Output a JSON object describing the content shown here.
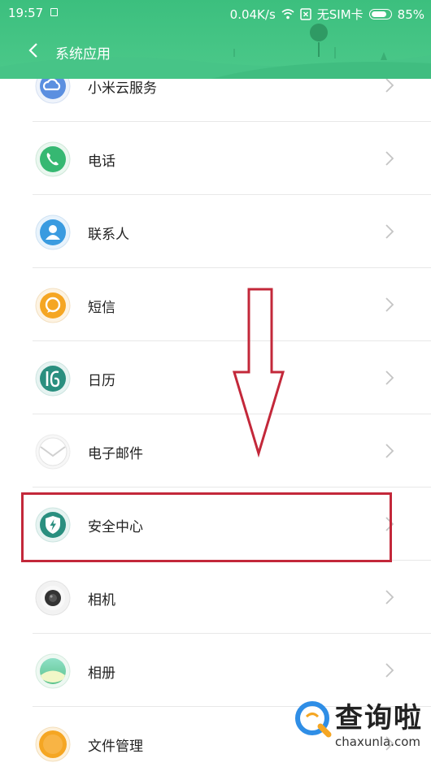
{
  "status_bar": {
    "time": "19:57",
    "speed": "0.04K/s",
    "sim": "无SIM卡",
    "battery": "85%",
    "battery_level": 0.85
  },
  "nav": {
    "title": "系统应用"
  },
  "apps": [
    {
      "label": "小米云服务",
      "icon": "cloud-icon",
      "color": "#5b8fe0"
    },
    {
      "label": "电话",
      "icon": "phone-icon",
      "color": "#36b872"
    },
    {
      "label": "联系人",
      "icon": "contacts-icon",
      "color": "#3a9be0"
    },
    {
      "label": "短信",
      "icon": "message-icon",
      "color": "#f5a623"
    },
    {
      "label": "日历",
      "icon": "calendar-icon",
      "color": "#2a8f7f"
    },
    {
      "label": "电子邮件",
      "icon": "mail-icon",
      "color": "#e8e8e8"
    },
    {
      "label": "安全中心",
      "icon": "shield-icon",
      "color": "#2a8f7f"
    },
    {
      "label": "相机",
      "icon": "camera-icon",
      "color": "#333333"
    },
    {
      "label": "相册",
      "icon": "gallery-icon",
      "color": "#6bcf9a"
    },
    {
      "label": "文件管理",
      "icon": "folder-icon",
      "color": "#f5a623"
    }
  ],
  "watermark": {
    "title": "查询啦",
    "site": "chaxunla.com"
  },
  "colors": {
    "header": "#3cbf7e",
    "annotation": "#c3283a"
  }
}
